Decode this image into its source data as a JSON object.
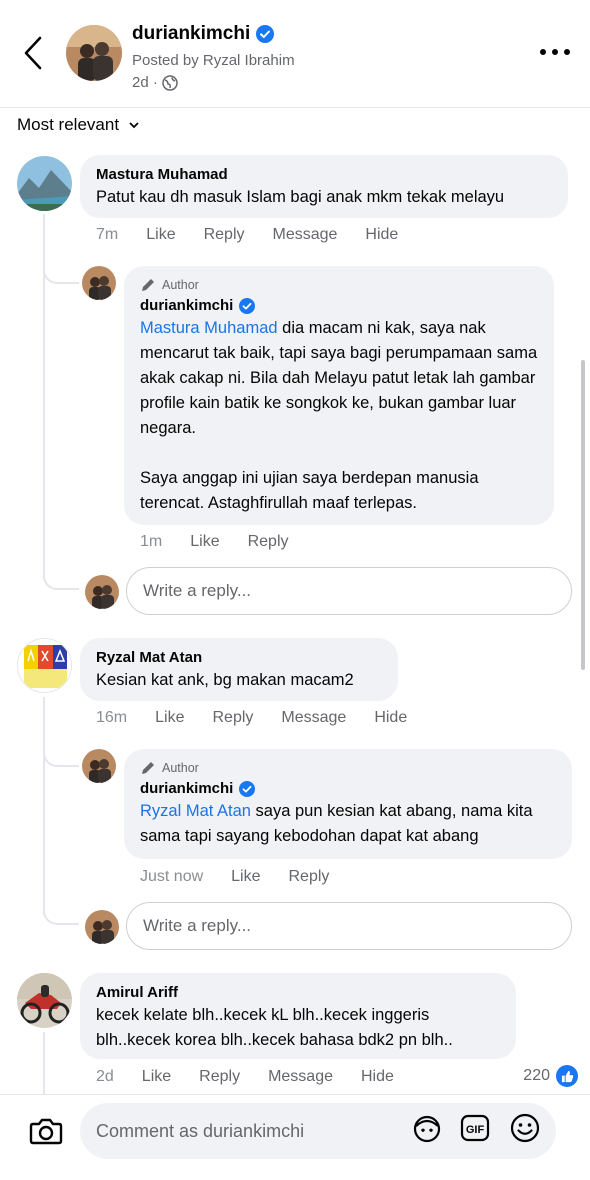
{
  "header": {
    "page_name": "duriankimchi",
    "posted_by": "Posted by Ryzal Ibrahim",
    "time": "2d ·"
  },
  "sort": {
    "label": "Most relevant"
  },
  "comments": [
    {
      "name": "Mastura Muhamad",
      "text": "Patut kau dh masuk Islam bagi anak mkm tekak melayu",
      "time": "7m",
      "like": "Like",
      "reply": "Reply",
      "message": "Message",
      "hide": "Hide",
      "reply_item": {
        "author_tag": "Author",
        "name": "duriankimchi",
        "mention": "Mastura Muhamad",
        "text": " dia macam ni kak, saya nak mencarut tak baik, tapi saya bagi perumpamaan sama akak cakap ni. Bila dah Melayu patut letak lah gambar profile kain batik ke songkok ke, bukan gambar luar negara.\n\nSaya anggap ini ujian saya berdepan manusia terencat. Astaghfirullah maaf terlepas.",
        "time": "1m",
        "like": "Like",
        "reply": "Reply"
      },
      "write_reply_placeholder": "Write a reply..."
    },
    {
      "name": "Ryzal Mat Atan",
      "text": "Kesian kat ank, bg makan macam2",
      "time": "16m",
      "like": "Like",
      "reply": "Reply",
      "message": "Message",
      "hide": "Hide",
      "reply_item": {
        "author_tag": "Author",
        "name": "duriankimchi",
        "mention": "Ryzal Mat Atan",
        "text": " saya pun kesian kat abang, nama kita sama tapi sayang kebodohan dapat kat abang",
        "time": "Just now",
        "like": "Like",
        "reply": "Reply"
      },
      "write_reply_placeholder": "Write a reply..."
    },
    {
      "name": "Amirul Ariff",
      "text": "kecek kelate blh..kecek kL blh..kecek inggeris blh..kecek korea blh..kecek bahasa bdk2 pn blh..",
      "time": "2d",
      "like": "Like",
      "reply": "Reply",
      "message": "Message",
      "hide": "Hide",
      "like_count": "220"
    }
  ],
  "composer": {
    "placeholder": "Comment as duriankimchi"
  },
  "colors": {
    "accent": "#1877f2",
    "bubble": "#f0f2f5",
    "muted_text": "#65676b"
  }
}
